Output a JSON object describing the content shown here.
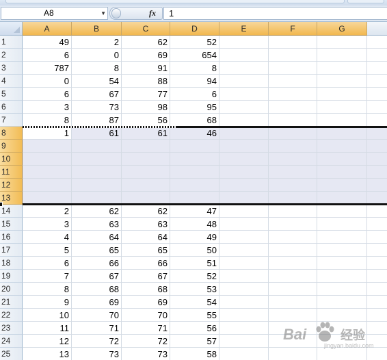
{
  "formula_bar": {
    "name_box": "A8",
    "fx_label": "fx",
    "value": "1"
  },
  "columns": [
    "A",
    "B",
    "C",
    "D",
    "E",
    "F",
    "G"
  ],
  "rows": [
    {
      "n": "1",
      "cells": [
        "49",
        "2",
        "62",
        "52"
      ]
    },
    {
      "n": "2",
      "cells": [
        "6",
        "0",
        "69",
        "654"
      ]
    },
    {
      "n": "3",
      "cells": [
        "787",
        "8",
        "91",
        "8"
      ]
    },
    {
      "n": "4",
      "cells": [
        "0",
        "54",
        "88",
        "94"
      ]
    },
    {
      "n": "5",
      "cells": [
        "6",
        "67",
        "77",
        "6"
      ]
    },
    {
      "n": "6",
      "cells": [
        "3",
        "73",
        "98",
        "95"
      ]
    },
    {
      "n": "7",
      "cells": [
        "8",
        "87",
        "56",
        "68"
      ]
    },
    {
      "n": "8",
      "cells": [
        "1",
        "61",
        "61",
        "46"
      ]
    },
    {
      "n": "9",
      "cells": [
        "",
        "",
        "",
        ""
      ]
    },
    {
      "n": "10",
      "cells": [
        "",
        "",
        "",
        ""
      ]
    },
    {
      "n": "11",
      "cells": [
        "",
        "",
        "",
        ""
      ]
    },
    {
      "n": "12",
      "cells": [
        "",
        "",
        "",
        ""
      ]
    },
    {
      "n": "13",
      "cells": [
        "",
        "",
        "",
        ""
      ]
    },
    {
      "n": "14",
      "cells": [
        "2",
        "62",
        "62",
        "47"
      ]
    },
    {
      "n": "15",
      "cells": [
        "3",
        "63",
        "63",
        "48"
      ]
    },
    {
      "n": "16",
      "cells": [
        "4",
        "64",
        "64",
        "49"
      ]
    },
    {
      "n": "17",
      "cells": [
        "5",
        "65",
        "65",
        "50"
      ]
    },
    {
      "n": "18",
      "cells": [
        "6",
        "66",
        "66",
        "51"
      ]
    },
    {
      "n": "19",
      "cells": [
        "7",
        "67",
        "67",
        "52"
      ]
    },
    {
      "n": "20",
      "cells": [
        "8",
        "68",
        "68",
        "53"
      ]
    },
    {
      "n": "21",
      "cells": [
        "9",
        "69",
        "69",
        "54"
      ]
    },
    {
      "n": "22",
      "cells": [
        "10",
        "70",
        "70",
        "55"
      ]
    },
    {
      "n": "23",
      "cells": [
        "11",
        "71",
        "71",
        "56"
      ]
    },
    {
      "n": "24",
      "cells": [
        "12",
        "72",
        "72",
        "57"
      ]
    },
    {
      "n": "25",
      "cells": [
        "13",
        "73",
        "73",
        "58"
      ]
    }
  ],
  "selection": {
    "active_cell": "A8",
    "selected_rows": [
      "8",
      "9",
      "10",
      "11",
      "12",
      "13"
    ],
    "highlighted_columns": [
      "A",
      "B",
      "C",
      "D",
      "E",
      "F",
      "G"
    ]
  },
  "watermark": {
    "text_left": "Bai",
    "text_right": "经验",
    "text_small": "jingyan.baidu.com",
    "icon": "baidu-paw-icon"
  }
}
